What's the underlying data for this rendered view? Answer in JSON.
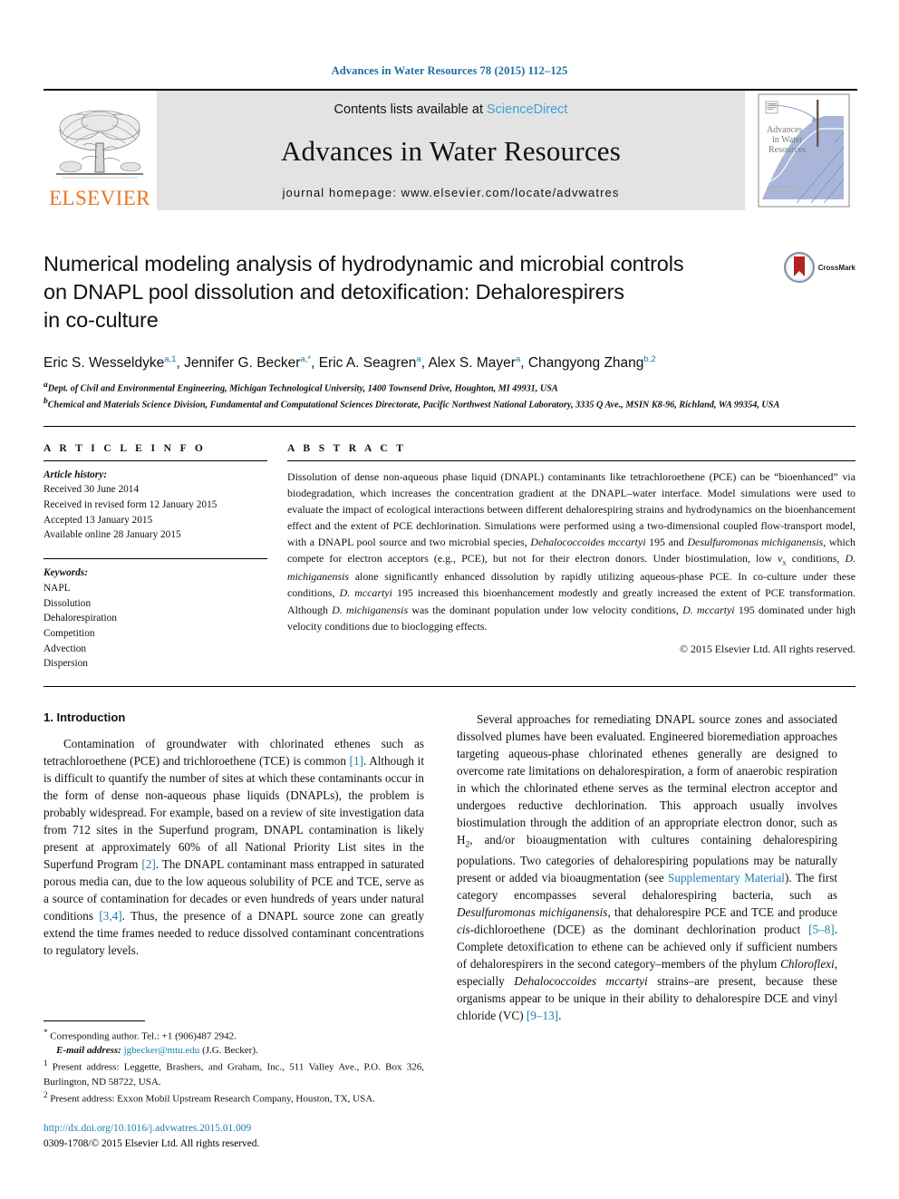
{
  "journal_ref": "Advances in Water Resources 78 (2015) 112–125",
  "masthead": {
    "publisher": "ELSEVIER",
    "contents_prefix": "Contents lists available at ",
    "contents_link": "ScienceDirect",
    "journal_title": "Advances in Water Resources",
    "homepage": "journal homepage: www.elsevier.com/locate/advwatres",
    "cover_title_line1": "Advances",
    "cover_title_line2": "in Water",
    "cover_title_line3": "Resources"
  },
  "article": {
    "title_line1": "Numerical modeling analysis of hydrodynamic and microbial controls",
    "title_line2": "on DNAPL pool dissolution and detoxification: Dehalorespirers",
    "title_line3": "in co-culture",
    "crossmark_label": "CrossMark",
    "authors": [
      {
        "name": "Eric S. Wesseldyke",
        "marks": "a,1"
      },
      {
        "name": "Jennifer G. Becker",
        "marks": "a,*"
      },
      {
        "name": "Eric A. Seagren",
        "marks": "a"
      },
      {
        "name": "Alex S. Mayer",
        "marks": "a"
      },
      {
        "name": "Changyong Zhang",
        "marks": "b,2"
      }
    ],
    "affiliations": [
      {
        "mark": "a",
        "text": "Dept. of Civil and Environmental Engineering, Michigan Technological University, 1400 Townsend Drive, Houghton, MI 49931, USA"
      },
      {
        "mark": "b",
        "text": "Chemical and Materials Science Division, Fundamental and Computational Sciences Directorate, Pacific Northwest National Laboratory, 3335 Q Ave., MSIN K8-96, Richland, WA 99354, USA"
      }
    ]
  },
  "info": {
    "heading": "A R T I C L E  I N F O",
    "history_label": "Article history:",
    "history": [
      "Received 30 June 2014",
      "Received in revised form 12 January 2015",
      "Accepted 13 January 2015",
      "Available online 28 January 2015"
    ],
    "keywords_label": "Keywords:",
    "keywords": [
      "NAPL",
      "Dissolution",
      "Dehalorespiration",
      "Competition",
      "Advection",
      "Dispersion"
    ]
  },
  "abstract": {
    "heading": "A B S T R A C T",
    "text": "Dissolution of dense non-aqueous phase liquid (DNAPL) contaminants like tetrachloroethene (PCE) can be “bioenhanced” via biodegradation, which increases the concentration gradient at the DNAPL–water interface. Model simulations were used to evaluate the impact of ecological interactions between different dehalorespiring strains and hydrodynamics on the bioenhancement effect and the extent of PCE dechlorination. Simulations were performed using a two-dimensional coupled flow-transport model, with a DNAPL pool source and two microbial species, Dehalococcoides mccartyi 195 and Desulfuromonas michiganensis, which compete for electron acceptors (e.g., PCE), but not for their electron donors. Under biostimulation, low vₓ conditions, D. michiganensis alone significantly enhanced dissolution by rapidly utilizing aqueous-phase PCE. In co-culture under these conditions, D. mccartyi 195 increased this bioenhancement modestly and greatly increased the extent of PCE transformation. Although D. michiganensis was the dominant population under low velocity conditions, D. mccartyi 195 dominated under high velocity conditions due to bioclogging effects.",
    "copyright": "© 2015 Elsevier Ltd. All rights reserved."
  },
  "body": {
    "section_title": "1. Introduction",
    "left_paragraphs": [
      "Contamination of groundwater with chlorinated ethenes such as tetrachloroethene (PCE) and trichloroethene (TCE) is common [1]. Although it is difficult to quantify the number of sites at which these contaminants occur in the form of dense non-aqueous phase liquids (DNAPLs), the problem is probably widespread. For example, based on a review of site investigation data from 712 sites in the Superfund program, DNAPL contamination is likely present at approximately 60% of all National Priority List sites in the Superfund Program [2]. The DNAPL contaminant mass entrapped in saturated porous media can, due to the low aqueous solubility of PCE and TCE, serve as a source of contamination for decades or even hundreds of years under natural conditions [3,4]. Thus, the presence of a DNAPL source zone can greatly extend the time frames needed to reduce dissolved contaminant concentrations to regulatory levels."
    ],
    "right_paragraphs": [
      "Several approaches for remediating DNAPL source zones and associated dissolved plumes have been evaluated. Engineered bioremediation approaches targeting aqueous-phase chlorinated ethenes generally are designed to overcome rate limitations on dehalorespiration, a form of anaerobic respiration in which the chlorinated ethene serves as the terminal electron acceptor and undergoes reductive dechlorination. This approach usually involves biostimulation through the addition of an appropriate electron donor, such as H2, and/or bioaugmentation with cultures containing dehalorespiring populations. Two categories of dehalorespiring populations may be naturally present or added via bioaugmentation (see Supplementary Material). The first category encompasses several dehalorespiring bacteria, such as Desulfuromonas michiganensis, that dehalorespire PCE and TCE and produce cis-dichloroethene (DCE) as the dominant dechlorination product [5–8]. Complete detoxification to ethene can be achieved only if sufficient numbers of dehalorespirers in the second category–members of the phylum Chloroflexi, especially Dehalococcoides mccartyi strains–are present, because these organisms appear to be unique in their ability to dehalorespire DCE and vinyl chloride (VC) [9–13]."
    ]
  },
  "footnotes": {
    "corresponding": "Corresponding author. Tel.: +1 (906)487 2942.",
    "email_label": "E-mail address:",
    "email": "jgbecker@mtu.edu",
    "email_suffix": "(J.G. Becker).",
    "note1": "Present address: Leggette, Brashers, and Graham, Inc., 511 Valley Ave., P.O. Box 326, Burlington, ND 58722, USA.",
    "note2": "Present address: Exxon Mobil Upstream Research Company, Houston, TX, USA.",
    "doi": "http://dx.doi.org/10.1016/j.advwatres.2015.01.009",
    "issn_line": "0309-1708/© 2015 Elsevier Ltd. All rights reserved."
  },
  "colors": {
    "link": "#1a7fae",
    "journal_ref": "#1a6fa3",
    "elsevier_orange": "#E87722",
    "sciencedirect": "#3ea0d8"
  }
}
